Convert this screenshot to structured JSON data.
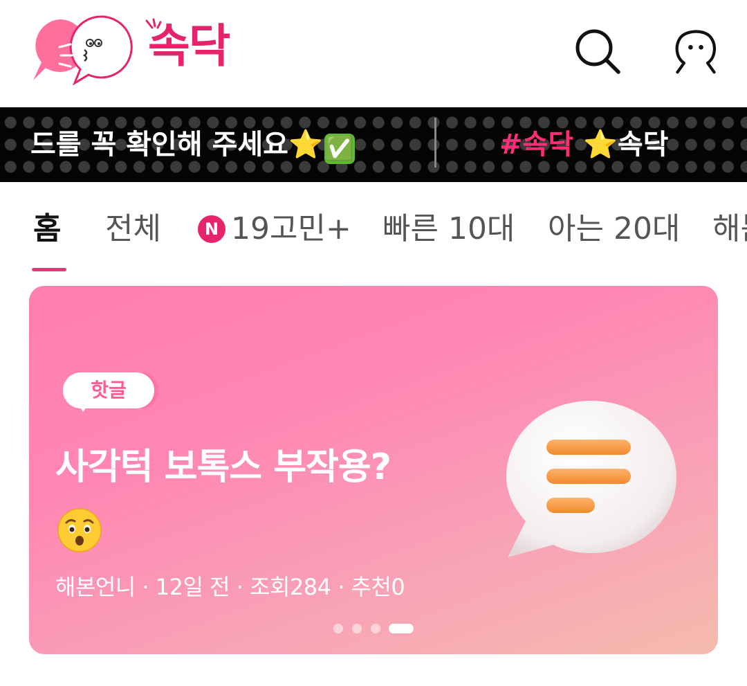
{
  "app": {
    "logo_text": "속닥"
  },
  "header": {
    "search_icon": "search-icon",
    "profile_icon": "profile-icon"
  },
  "ticker": {
    "left_text": "드를 꼭 확인해 주세요",
    "left_emojis": [
      "⭐",
      "✅"
    ],
    "right_hashtag": "#속닥",
    "right_star": "⭐",
    "right_text": "속닥"
  },
  "tabs": [
    {
      "label": "홈",
      "active": true
    },
    {
      "label": "전체",
      "active": false
    },
    {
      "label": "19고민+",
      "badge": "N",
      "active": false
    },
    {
      "label": "빠른 10대",
      "active": false
    },
    {
      "label": "아는 20대",
      "active": false
    },
    {
      "label": "해봄",
      "active": false
    }
  ],
  "banner": {
    "badge": "핫글",
    "title": "사각턱 보톡스 부작용?",
    "emoji": "hushed-face-emoji",
    "meta": "해본언니 · 12일 전 · 조회284 · 추천0",
    "page_count": 4,
    "active_page": 4
  },
  "colors": {
    "brand": "#e5246b",
    "banner_start": "#ff7fae",
    "banner_end": "#f5bbad",
    "tab_underline": "#ff2e7a"
  }
}
